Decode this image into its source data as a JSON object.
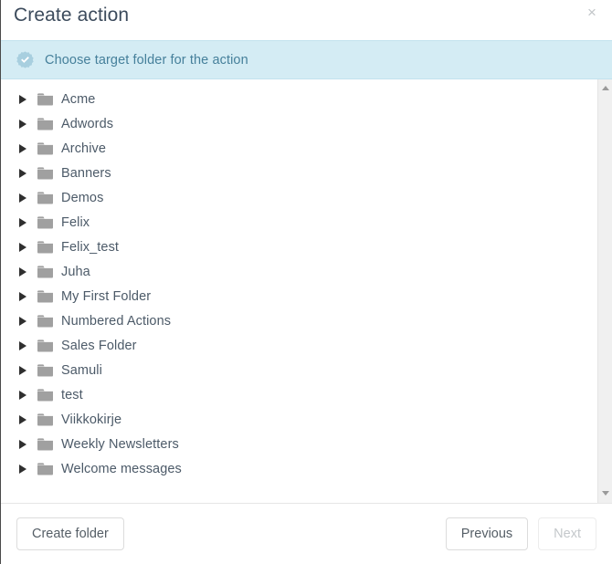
{
  "dialog": {
    "title": "Create action",
    "close_label": "×",
    "close_icon": "close-icon"
  },
  "banner": {
    "icon": "badge-check-icon",
    "text": "Choose target folder for the action",
    "background_color": "#d4ecf4",
    "text_color": "#46809b"
  },
  "folder_list": {
    "expand_arrow_icon": "triangle-right-icon",
    "folder_icon": "folder-icon",
    "items": [
      {
        "label": "Acme"
      },
      {
        "label": "Adwords"
      },
      {
        "label": "Archive"
      },
      {
        "label": "Banners"
      },
      {
        "label": "Demos"
      },
      {
        "label": "Felix"
      },
      {
        "label": "Felix_test"
      },
      {
        "label": "Juha"
      },
      {
        "label": "My First Folder"
      },
      {
        "label": "Numbered Actions"
      },
      {
        "label": "Sales Folder"
      },
      {
        "label": "Samuli"
      },
      {
        "label": "test"
      },
      {
        "label": "Viikkokirje"
      },
      {
        "label": "Weekly Newsletters"
      },
      {
        "label": "Welcome messages"
      }
    ]
  },
  "scrollbar": {
    "up_icon": "scroll-arrow-up-icon",
    "down_icon": "scroll-arrow-down-icon"
  },
  "footer": {
    "create_folder_label": "Create folder",
    "previous_label": "Previous",
    "next_label": "Next",
    "next_disabled": true
  }
}
